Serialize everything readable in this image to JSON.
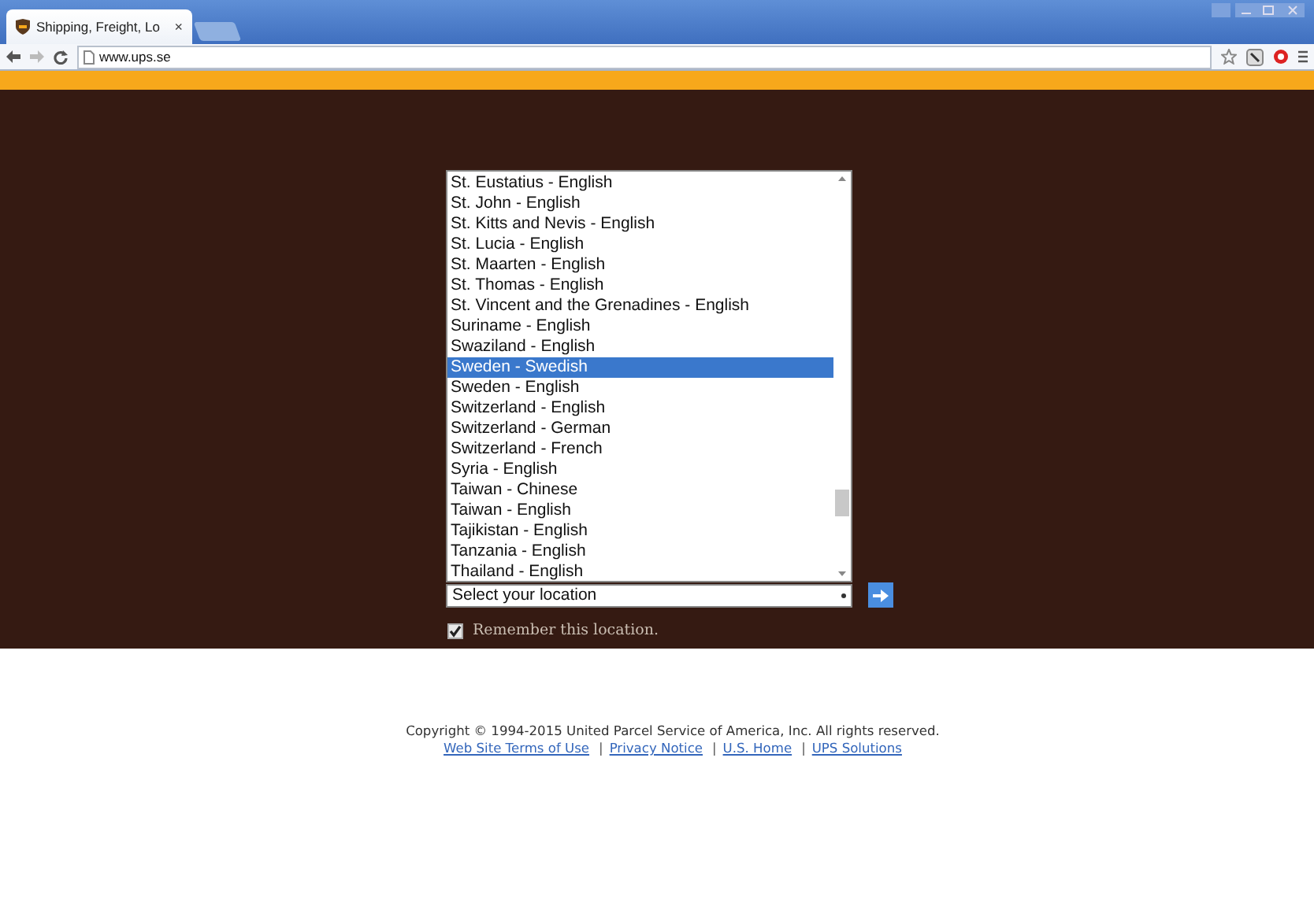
{
  "browser": {
    "tab_title": "Shipping, Freight, Lo",
    "tab_close": "×",
    "url": "www.ups.se"
  },
  "location_list": {
    "items": [
      {
        "label": "St. Eustatius - English",
        "selected": false
      },
      {
        "label": "St. John - English",
        "selected": false
      },
      {
        "label": "St. Kitts and Nevis - English",
        "selected": false
      },
      {
        "label": "St. Lucia - English",
        "selected": false
      },
      {
        "label": "St. Maarten - English",
        "selected": false
      },
      {
        "label": "St. Thomas - English",
        "selected": false
      },
      {
        "label": "St. Vincent and the Grenadines - English",
        "selected": false
      },
      {
        "label": "Suriname - English",
        "selected": false
      },
      {
        "label": "Swaziland - English",
        "selected": false
      },
      {
        "label": "Sweden - Swedish",
        "selected": true
      },
      {
        "label": "Sweden - English",
        "selected": false
      },
      {
        "label": "Switzerland - English",
        "selected": false
      },
      {
        "label": "Switzerland - German",
        "selected": false
      },
      {
        "label": "Switzerland - French",
        "selected": false
      },
      {
        "label": "Syria - English",
        "selected": false
      },
      {
        "label": "Taiwan - Chinese",
        "selected": false
      },
      {
        "label": "Taiwan - English",
        "selected": false
      },
      {
        "label": "Tajikistan - English",
        "selected": false
      },
      {
        "label": "Tanzania - English",
        "selected": false
      },
      {
        "label": "Thailand - English",
        "selected": false
      }
    ]
  },
  "location_select": {
    "value": "Select your location"
  },
  "remember": {
    "label": "Remember this location.",
    "checked": true
  },
  "footer": {
    "copyright": "Copyright © 1994-2015 United Parcel Service of America, Inc. All rights reserved.",
    "separator": "|",
    "links": [
      "Web Site Terms of Use",
      "Privacy Notice",
      "U.S. Home",
      "UPS Solutions"
    ]
  }
}
